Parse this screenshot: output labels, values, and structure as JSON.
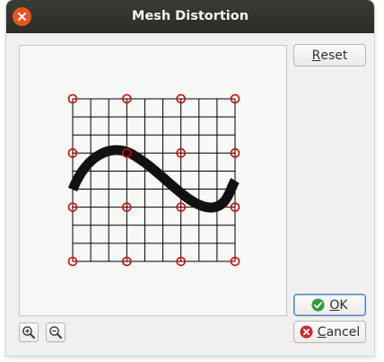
{
  "window": {
    "title": "Mesh Distortion"
  },
  "buttons": {
    "reset": {
      "mnemonic": "R",
      "rest": "eset"
    },
    "ok": {
      "mnemonic": "O",
      "rest": "K"
    },
    "cancel": {
      "mnemonic": "C",
      "rest": "ancel"
    }
  },
  "icons": {
    "close": "close-icon",
    "ok": "checkmark-icon",
    "cancel": "cancel-icon",
    "zoom_in": "zoom-in-icon",
    "zoom_out": "zoom-out-icon"
  },
  "colors": {
    "close_button": "#e95420",
    "ok_icon": "#2e9d3b",
    "cancel_icon": "#cc2828",
    "control_point": "#e00000",
    "grid_line": "#000000",
    "curve": "#111111"
  },
  "mesh": {
    "grid_cells": 9,
    "control_points_per_side": 4
  }
}
